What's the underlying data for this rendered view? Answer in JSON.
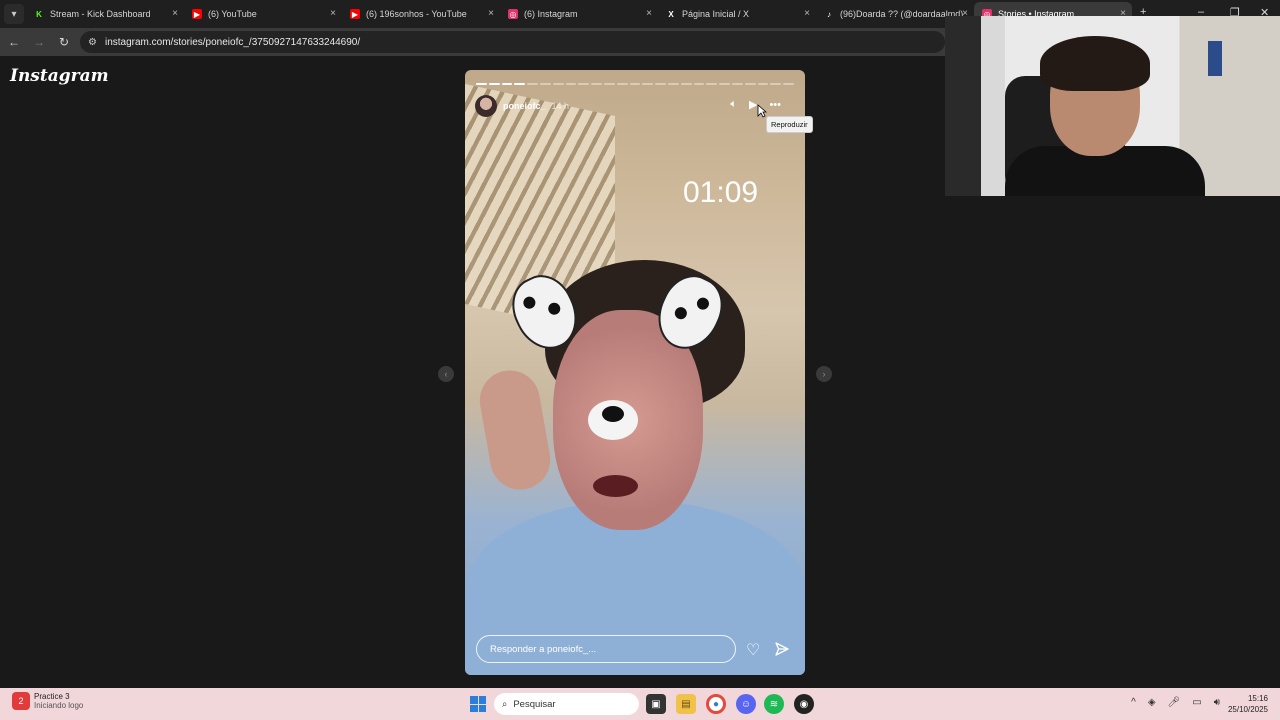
{
  "tabs": [
    {
      "label": "Stream - Kick Dashboard",
      "icon": "kick-icon"
    },
    {
      "label": "(6) YouTube",
      "icon": "youtube-icon"
    },
    {
      "label": "(6) 196sonhos - YouTube",
      "icon": "youtube-icon"
    },
    {
      "label": "(6) Instagram",
      "icon": "instagram-icon"
    },
    {
      "label": "Página Inicial / X",
      "icon": "x-icon"
    },
    {
      "label": "(96)Doarda ?? (@doardaalmd)",
      "icon": "tiktok-icon"
    },
    {
      "label": "Stories • Instagram",
      "icon": "instagram-icon",
      "active": true
    }
  ],
  "address": {
    "url": "instagram.com/stories/poneiofc_/3750927147633244690/"
  },
  "page": {
    "logo": "Instagram",
    "story": {
      "username": "poneiofc_",
      "time_ago": "14 h",
      "overlay_text": "01:09",
      "tooltip": "Reproduzir",
      "reply_placeholder": "Responder a poneiofc_...",
      "segments_total": 25,
      "segments_done": 4
    }
  },
  "taskbar": {
    "notification_title": "Practice 3",
    "notification_sub": "Iniciando logo",
    "notification_badge": "2",
    "search_placeholder": "Pesquisar",
    "time": "15:16",
    "date": "25/10/2025"
  },
  "colors": {
    "instagram": "#e1306c",
    "youtube": "#ff0000",
    "kick": "#53fc18"
  }
}
